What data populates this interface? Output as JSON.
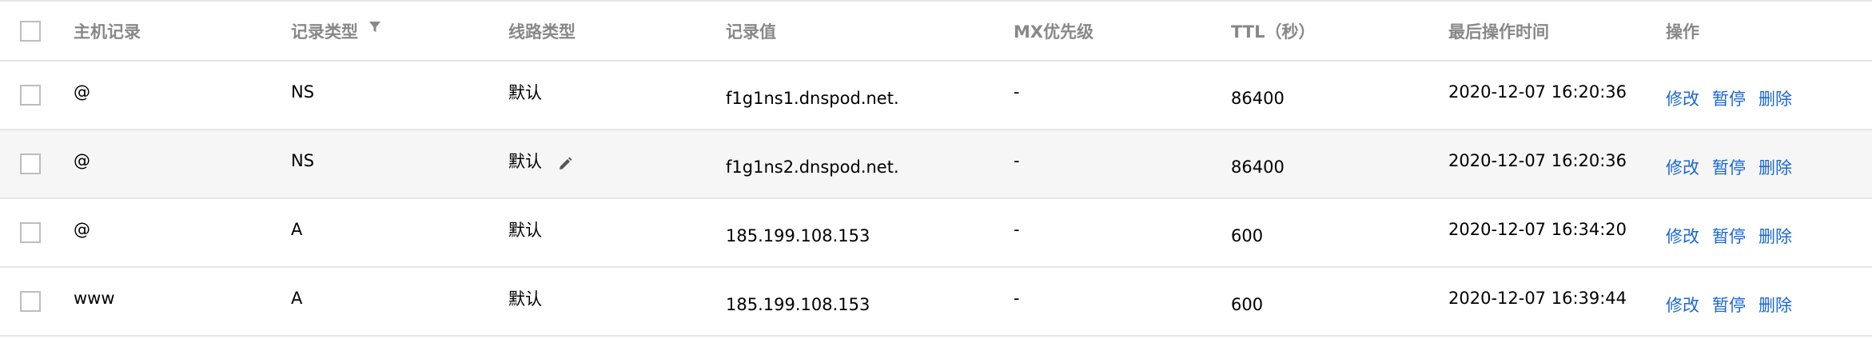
{
  "header": {
    "host": "主机记录",
    "type": "记录类型",
    "line": "线路类型",
    "value": "记录值",
    "mx": "MX优先级",
    "ttl": "TTL（秒）",
    "time": "最后操作时间",
    "ops": "操作"
  },
  "rows": [
    {
      "host": "@",
      "type": "NS",
      "line": "默认",
      "value": "f1g1ns1.dnspod.net.",
      "mx": "-",
      "ttl": "86400",
      "time": "2020-12-07 16:20:36",
      "edit": "修改",
      "pause": "暂停",
      "delete": "删除"
    },
    {
      "host": "@",
      "type": "NS",
      "line": "默认",
      "value": "f1g1ns2.dnspod.net.",
      "mx": "-",
      "ttl": "86400",
      "time": "2020-12-07 16:20:36",
      "edit": "修改",
      "pause": "暂停",
      "delete": "删除"
    },
    {
      "host": "@",
      "type": "A",
      "line": "默认",
      "value": "185.199.108.153",
      "mx": "-",
      "ttl": "600",
      "time": "2020-12-07 16:34:20",
      "edit": "修改",
      "pause": "暂停",
      "delete": "删除"
    },
    {
      "host": "www",
      "type": "A",
      "line": "默认",
      "value": "185.199.108.153",
      "mx": "-",
      "ttl": "600",
      "time": "2020-12-07 16:39:44",
      "edit": "修改",
      "pause": "暂停",
      "delete": "删除"
    }
  ],
  "icons": {
    "filter": "filter-icon",
    "edit": "pencil-icon"
  },
  "colors": {
    "link": "#1a66d6",
    "header_text": "#888888",
    "border": "#e6e6e6",
    "hover_row": "#f6f6f6"
  }
}
